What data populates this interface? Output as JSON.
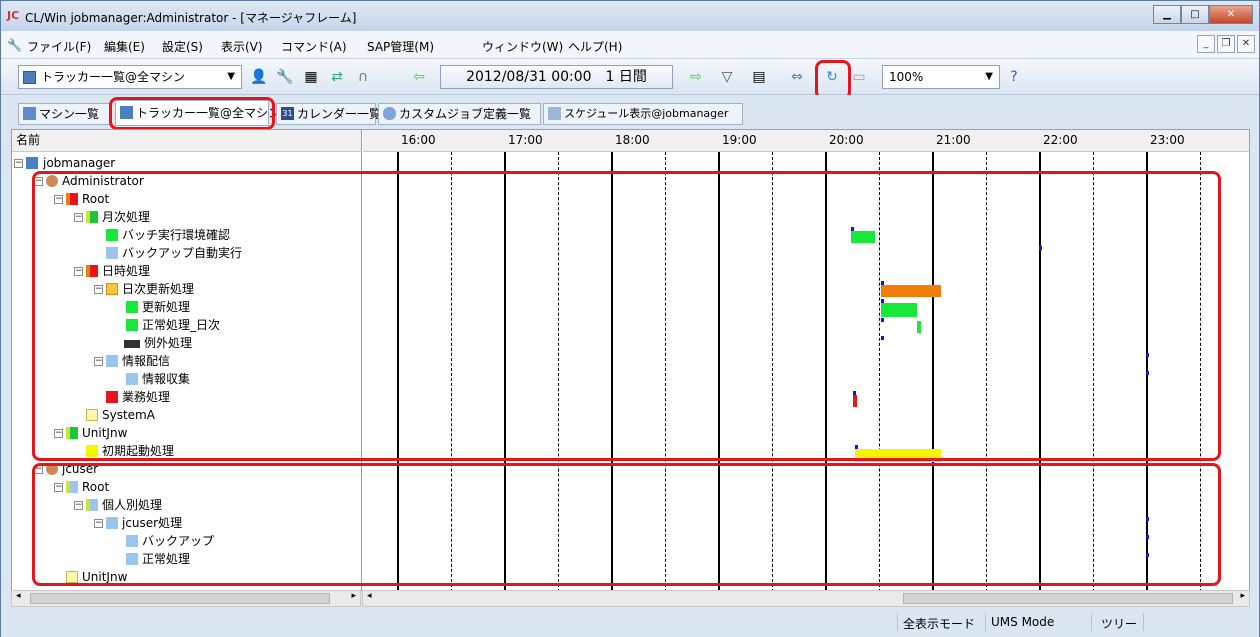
{
  "window": {
    "logo": "JC",
    "title": "CL/Win jobmanager:Administrator - [マネージャフレーム]",
    "controls": [
      "minimize",
      "maximize",
      "close"
    ]
  },
  "menu": {
    "items": [
      "ファイル(F)",
      "編集(E)",
      "設定(S)",
      "表示(V)",
      "コマンド(A)",
      "SAP管理(M)",
      "ウィンドウ(W)",
      "ヘルプ(H)"
    ]
  },
  "toolbar": {
    "view_selector": "トラッカー一覧@全マシン",
    "date_range": "2012/08/31 00:00　1 日間",
    "zoom": "100%"
  },
  "tabs": [
    "マシン一覧",
    "トラッカー一覧@全マシン",
    "カレンダー一覧",
    "カスタムジョブ定義一覧",
    "スケジュール表示@jobmanager"
  ],
  "tree": {
    "header": "名前",
    "nodes": [
      {
        "label": "jobmanager"
      },
      {
        "label": "Administrator"
      },
      {
        "label": "Root"
      },
      {
        "label": "月次処理"
      },
      {
        "label": "バッチ実行環境確認"
      },
      {
        "label": "バックアップ自動実行"
      },
      {
        "label": "日時処理"
      },
      {
        "label": "日次更新処理"
      },
      {
        "label": "更新処理"
      },
      {
        "label": "正常処理_日次"
      },
      {
        "label": "例外処理"
      },
      {
        "label": "情報配信"
      },
      {
        "label": "情報収集"
      },
      {
        "label": "業務処理"
      },
      {
        "label": "SystemA"
      },
      {
        "label": "UnitJnw"
      },
      {
        "label": "初期起動処理"
      },
      {
        "label": "jcuser"
      },
      {
        "label": "Root"
      },
      {
        "label": "個人別処理"
      },
      {
        "label": "jcuser処理"
      },
      {
        "label": "バックアップ"
      },
      {
        "label": "正常処理"
      },
      {
        "label": "UnitJnw"
      }
    ]
  },
  "gantt": {
    "hours": [
      "16:00",
      "17:00",
      "18:00",
      "19:00",
      "20:00",
      "21:00",
      "22:00",
      "23:00"
    ]
  },
  "status": {
    "mode": "全表示モード",
    "ums": "UMS Mode",
    "view": "ツリー"
  },
  "colors": {
    "highlight": "#e8141c",
    "running_green": "#17e83a",
    "orange": "#f07d0a",
    "yellow": "#f5f500",
    "error_red": "#e8141c",
    "marker_blue": "#1414e0"
  }
}
